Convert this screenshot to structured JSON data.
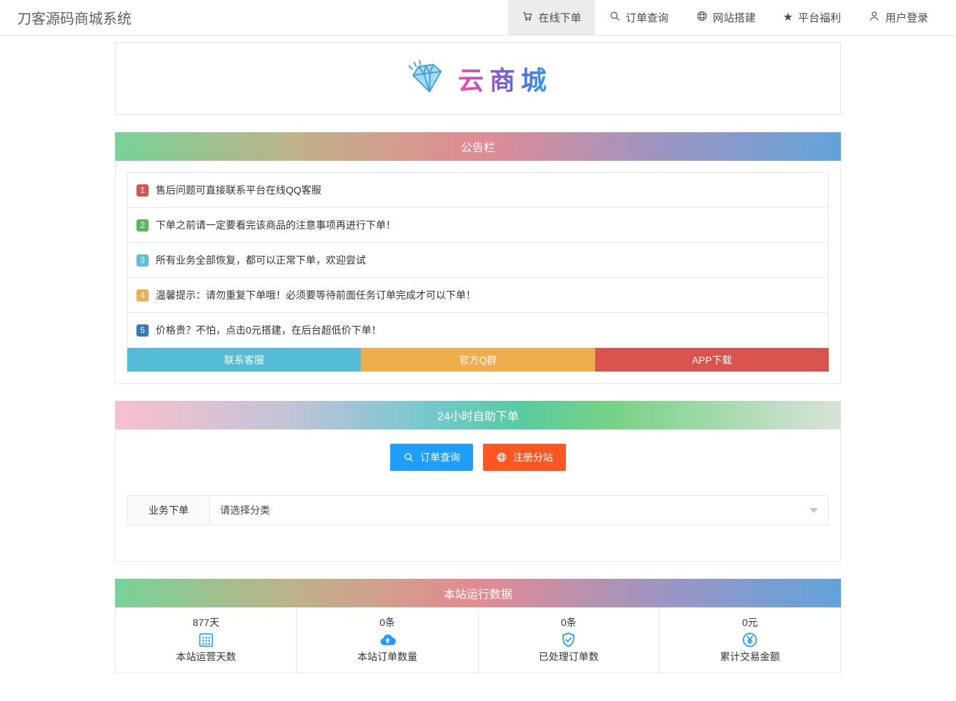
{
  "navbar": {
    "brand": "刀客源码商城系统",
    "items": [
      {
        "label": "在线下单",
        "icon": "cart-icon",
        "active": true
      },
      {
        "label": "订单查询",
        "icon": "search-icon",
        "active": false
      },
      {
        "label": "网站搭建",
        "icon": "globe-icon",
        "active": false
      },
      {
        "label": "平台福利",
        "icon": "star-icon",
        "active": false
      },
      {
        "label": "用户登录",
        "icon": "user-icon",
        "active": false
      }
    ]
  },
  "logo": {
    "icon": "diamond-icon",
    "text": "云商城"
  },
  "announcement": {
    "header": "公告栏",
    "items": [
      {
        "num": "1",
        "color": "#d9534f",
        "text": "售后问题可直接联系平台在线QQ客服"
      },
      {
        "num": "2",
        "color": "#5cb85c",
        "text": "下单之前请一定要看完该商品的注意事项再进行下单！"
      },
      {
        "num": "3",
        "color": "#5bc0de",
        "text": "所有业务全部恢复，都可以正常下单，欢迎尝试"
      },
      {
        "num": "4",
        "color": "#f0ad4e",
        "text": "温馨提示：请勿重复下单哦！必须要等待前面任务订单完成才可以下单！"
      },
      {
        "num": "5",
        "color": "#337ab7",
        "text": "价格贵？不怕，点击0元搭建，在后台超低价下单！"
      }
    ],
    "buttons": [
      {
        "label": "联系客服",
        "color": "#54bcd4"
      },
      {
        "label": "官方Q群",
        "color": "#f0ad4e"
      },
      {
        "label": "APP下载",
        "color": "#d9534f"
      }
    ]
  },
  "self_service": {
    "header": "24小时自助下单",
    "buttons": [
      {
        "label": "订单查询",
        "icon": "search-icon",
        "color": "#1E9FFF"
      },
      {
        "label": "注册分站",
        "icon": "globe-icon",
        "color": "#FF5722"
      }
    ],
    "form": {
      "label": "业务下单",
      "placeholder": "请选择分类"
    }
  },
  "stats": {
    "header": "本站运行数据",
    "items": [
      {
        "value": "877天",
        "icon": "calendar-icon",
        "label": "本站运营天数"
      },
      {
        "value": "0条",
        "icon": "cloud-upload-icon",
        "label": "本站订单数量"
      },
      {
        "value": "0条",
        "icon": "shield-check-icon",
        "label": "已处理订单数"
      },
      {
        "value": "0元",
        "icon": "yen-circle-icon",
        "label": "累计交易金额"
      }
    ]
  },
  "colors": {
    "accent_blue": "#1E9FFF",
    "accent_orange_red": "#FF5722"
  }
}
